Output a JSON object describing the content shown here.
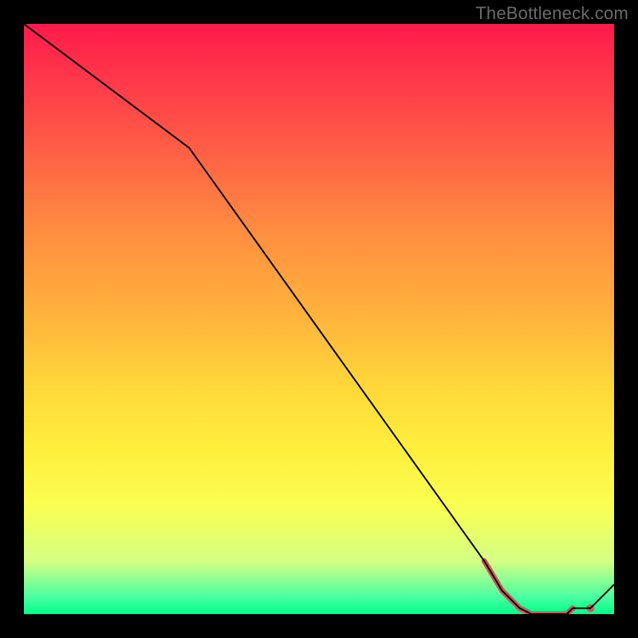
{
  "watermark": "TheBottleneck.com",
  "chart_data": {
    "type": "line",
    "title": "",
    "xlabel": "",
    "ylabel": "",
    "xlim": [
      0,
      100
    ],
    "ylim": [
      0,
      100
    ],
    "grid": false,
    "legend": false,
    "background_gradient": {
      "direction": "vertical",
      "stops": [
        {
          "pos": 0.0,
          "color": "#ff1a4b"
        },
        {
          "pos": 0.1,
          "color": "#ff3a4a"
        },
        {
          "pos": 0.25,
          "color": "#ff6b44"
        },
        {
          "pos": 0.35,
          "color": "#ff8d40"
        },
        {
          "pos": 0.5,
          "color": "#ffb53c"
        },
        {
          "pos": 0.62,
          "color": "#ffd93a"
        },
        {
          "pos": 0.72,
          "color": "#ffef3c"
        },
        {
          "pos": 0.82,
          "color": "#f9ff53"
        },
        {
          "pos": 0.91,
          "color": "#d4ff85"
        },
        {
          "pos": 0.97,
          "color": "#4bffa2"
        },
        {
          "pos": 1.0,
          "color": "#00ff88"
        }
      ]
    },
    "series": [
      {
        "name": "main-curve",
        "color": "#000000",
        "stroke_width": 2,
        "x": [
          0,
          28,
          78,
          81,
          84,
          86,
          88,
          90,
          92,
          93,
          96,
          100
        ],
        "y": [
          100,
          79,
          9,
          4,
          1,
          0,
          0,
          0,
          0,
          1,
          1,
          5
        ]
      }
    ],
    "highlight": {
      "name": "bottom-highlight",
      "color": "#cb5a5a",
      "stroke_width": 7,
      "linecap": "round",
      "x": [
        78,
        81,
        84,
        86,
        88,
        90,
        92,
        93
      ],
      "y": [
        9,
        4,
        1,
        0,
        0,
        0,
        0,
        1
      ]
    },
    "marker": {
      "name": "end-dot",
      "color": "#cb5a5a",
      "r": 5,
      "x": 96,
      "y": 1
    }
  }
}
